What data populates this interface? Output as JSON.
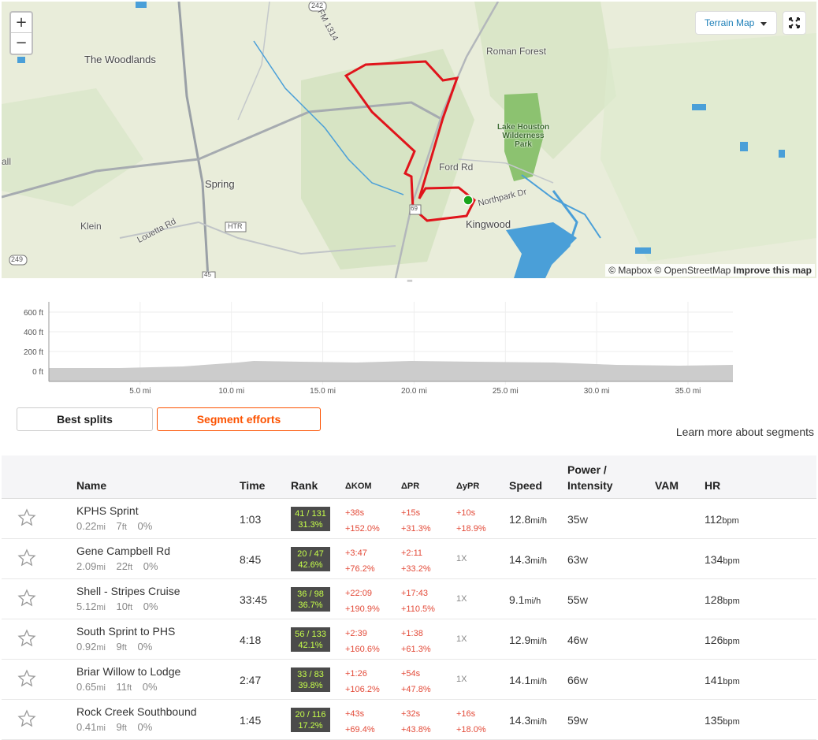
{
  "map": {
    "zoom_in": "+",
    "zoom_out": "−",
    "terrain_label": "Terrain Map",
    "attribution_mapbox": "© Mapbox",
    "attribution_osm": "© OpenStreetMap",
    "attribution_improve": "Improve this map",
    "labels": {
      "woodlands": "The Woodlands",
      "roman_forest": "Roman Forest",
      "spring": "Spring",
      "klein": "Klein",
      "kingwood": "Kingwood",
      "ford_rd": "Ford Rd",
      "northpark_dr": "Northpark Dr",
      "louetta_rd": "Louetta Rd",
      "fm1314": "FM 1314",
      "park": "Lake Houston Wilderness Park",
      "all": "all",
      "shield_242": "242",
      "shield_249": "249",
      "shield_45": "45",
      "shield_htr": "HTR",
      "shield_69": "69"
    },
    "colors": {
      "route": "#e0141b",
      "start_marker": "#19a41b",
      "water": "#4a9fd8",
      "park": "#8cc270"
    }
  },
  "elevation": {
    "y_ticks": [
      "600 ft",
      "400 ft",
      "200 ft",
      "0 ft"
    ],
    "x_ticks": [
      "5.0 mi",
      "10.0 mi",
      "15.0 mi",
      "20.0 mi",
      "25.0 mi",
      "30.0 mi",
      "35.0 mi"
    ]
  },
  "tabs": {
    "best_splits": "Best splits",
    "segment_efforts": "Segment efforts"
  },
  "learn_more": "Learn more about segments",
  "table": {
    "headers": {
      "name": "Name",
      "time": "Time",
      "rank": "Rank",
      "dkom": "ΔKOM",
      "dpr": "ΔPR",
      "dypr": "ΔyPR",
      "speed": "Speed",
      "power_1": "Power /",
      "power_2": "Intensity",
      "vam": "VAM",
      "hr": "HR"
    },
    "rows": [
      {
        "name": "KPHS Sprint",
        "dist": "0.22",
        "dist_unit": "mi",
        "elev": "7",
        "elev_unit": "ft",
        "grade": "0%",
        "time": "1:03",
        "rank_top": "41 / 131",
        "rank_pct": "31.3%",
        "dkom_1": "+38s",
        "dkom_2": "+152.0%",
        "dpr_1": "+15s",
        "dpr_2": "+31.3%",
        "dypr_1": "+10s",
        "dypr_2": "+18.9%",
        "speed": "12.8",
        "speed_unit": "mi/h",
        "power": "35",
        "power_unit": "W",
        "hr": "112",
        "hr_unit": "bpm"
      },
      {
        "name": "Gene Campbell Rd",
        "dist": "2.09",
        "dist_unit": "mi",
        "elev": "22",
        "elev_unit": "ft",
        "grade": "0%",
        "time": "8:45",
        "rank_top": "20 / 47",
        "rank_pct": "42.6%",
        "dkom_1": "+3:47",
        "dkom_2": "+76.2%",
        "dpr_1": "+2:11",
        "dpr_2": "+33.2%",
        "dypr_1": "1X",
        "dypr_2": "",
        "speed": "14.3",
        "speed_unit": "mi/h",
        "power": "63",
        "power_unit": "W",
        "hr": "134",
        "hr_unit": "bpm"
      },
      {
        "name": "Shell - Stripes Cruise",
        "dist": "5.12",
        "dist_unit": "mi",
        "elev": "10",
        "elev_unit": "ft",
        "grade": "0%",
        "time": "33:45",
        "rank_top": "36 / 98",
        "rank_pct": "36.7%",
        "dkom_1": "+22:09",
        "dkom_2": "+190.9%",
        "dpr_1": "+17:43",
        "dpr_2": "+110.5%",
        "dypr_1": "1X",
        "dypr_2": "",
        "speed": "9.1",
        "speed_unit": "mi/h",
        "power": "55",
        "power_unit": "W",
        "hr": "128",
        "hr_unit": "bpm"
      },
      {
        "name": "South Sprint to PHS",
        "dist": "0.92",
        "dist_unit": "mi",
        "elev": "9",
        "elev_unit": "ft",
        "grade": "0%",
        "time": "4:18",
        "rank_top": "56 / 133",
        "rank_pct": "42.1%",
        "dkom_1": "+2:39",
        "dkom_2": "+160.6%",
        "dpr_1": "+1:38",
        "dpr_2": "+61.3%",
        "dypr_1": "1X",
        "dypr_2": "",
        "speed": "12.9",
        "speed_unit": "mi/h",
        "power": "46",
        "power_unit": "W",
        "hr": "126",
        "hr_unit": "bpm"
      },
      {
        "name": "Briar Willow to Lodge",
        "dist": "0.65",
        "dist_unit": "mi",
        "elev": "11",
        "elev_unit": "ft",
        "grade": "0%",
        "time": "2:47",
        "rank_top": "33 / 83",
        "rank_pct": "39.8%",
        "dkom_1": "+1:26",
        "dkom_2": "+106.2%",
        "dpr_1": "+54s",
        "dpr_2": "+47.8%",
        "dypr_1": "1X",
        "dypr_2": "",
        "speed": "14.1",
        "speed_unit": "mi/h",
        "power": "66",
        "power_unit": "W",
        "hr": "141",
        "hr_unit": "bpm"
      },
      {
        "name": "Rock Creek Southbound",
        "dist": "0.41",
        "dist_unit": "mi",
        "elev": "9",
        "elev_unit": "ft",
        "grade": "0%",
        "time": "1:45",
        "rank_top": "20 / 116",
        "rank_pct": "17.2%",
        "dkom_1": "+43s",
        "dkom_2": "+69.4%",
        "dpr_1": "+32s",
        "dpr_2": "+43.8%",
        "dypr_1": "+16s",
        "dypr_2": "+18.0%",
        "speed": "14.3",
        "speed_unit": "mi/h",
        "power": "59",
        "power_unit": "W",
        "hr": "135",
        "hr_unit": "bpm"
      }
    ]
  }
}
